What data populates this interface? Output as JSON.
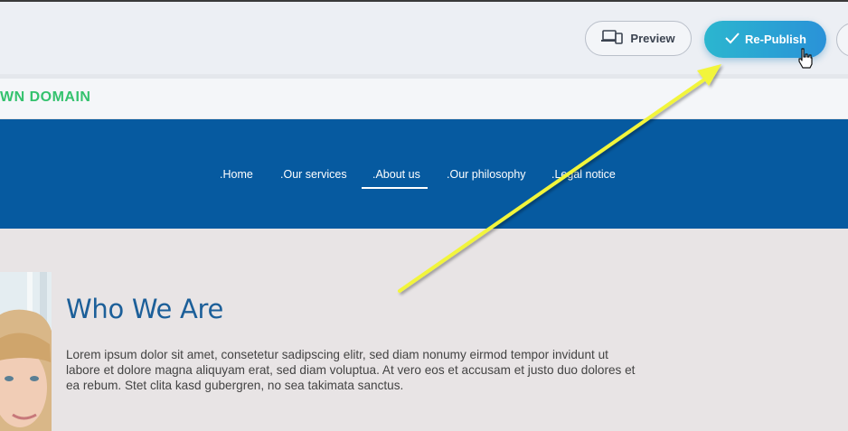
{
  "toolbar": {
    "preview_label": "Preview",
    "republish_label": "Re-Publish"
  },
  "domain_banner": {
    "text": "WN DOMAIN"
  },
  "nav": {
    "items": [
      {
        "label": ".Home"
      },
      {
        "label": ".Our services"
      },
      {
        "label": ".About us",
        "active": true
      },
      {
        "label": ".Our philosophy"
      },
      {
        "label": ".Legal notice"
      }
    ]
  },
  "content": {
    "title": "Who We Are",
    "body": "Lorem ipsum dolor sit amet, consetetur sadipscing elitr, sed diam nonumy eirmod tempor invidunt ut labore et dolore magna aliquyam erat, sed diam voluptua. At vero eos et accusam et justo duo dolores et ea rebum. Stet clita kasd gubergren, no sea takimata sanctus."
  },
  "colors": {
    "nav_background": "#065aa0",
    "republish_gradient_start": "#2bb6cf",
    "republish_gradient_end": "#2a92d8",
    "domain_text": "#34c26e",
    "annotation_arrow": "#f2f53a",
    "title": "#1c5f99"
  },
  "icons": {
    "preview": "devices-icon",
    "republish": "checkmark-icon",
    "cursor": "hand-pointer-icon"
  }
}
